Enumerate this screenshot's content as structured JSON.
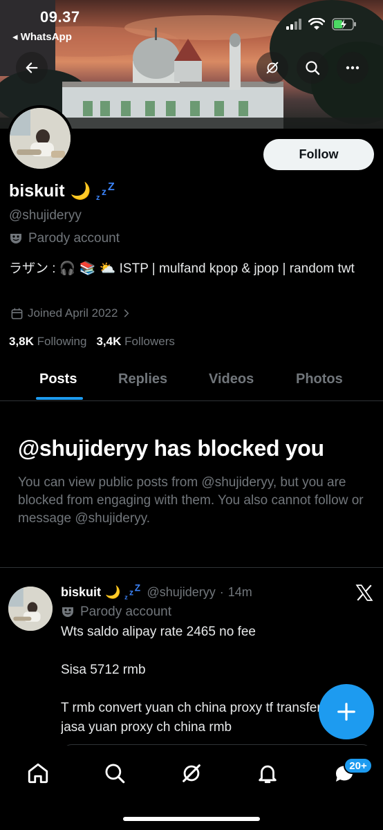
{
  "status_bar": {
    "time": "09.37",
    "back_app": "◂ WhatsApp"
  },
  "header": {
    "back_icon": "arrow-left-icon",
    "actions": [
      "grok-icon",
      "search-icon",
      "more-icon"
    ]
  },
  "profile": {
    "display_name": "biskuit",
    "name_emoji": "🌙",
    "handle": "@shujideryy",
    "parody_label": "Parody account",
    "bio": "ラザン : 🎧 📚 ⛅ ISTP | mulfand kpop & jpop | random twt",
    "joined": "Joined April 2022",
    "following_count": "3,8K",
    "following_label": "Following",
    "followers_count": "3,4K",
    "followers_label": "Followers",
    "follow_button": "Follow"
  },
  "tabs": [
    {
      "label": "Posts",
      "active": true
    },
    {
      "label": "Replies",
      "active": false
    },
    {
      "label": "Videos",
      "active": false
    },
    {
      "label": "Photos",
      "active": false
    }
  ],
  "blocked": {
    "title": "@shujideryy has blocked you",
    "description": "You can view public posts from @shujideryy, but you are blocked from engaging with them. You also cannot follow or message @shujideryy."
  },
  "post": {
    "name": "biskuit",
    "name_emoji": "🌙",
    "handle": "@shujideryy",
    "separator": "·",
    "time": "14m",
    "parody_label": "Parody account",
    "body": "Wts saldo alipay rate 2465 no fee\n\nSisa 5712 rmb\n\nT rmb convert yuan ch china proxy tf transfer\njasa yuan proxy ch china rmb"
  },
  "fab": {
    "icon": "plus-icon"
  },
  "bottom_nav": {
    "items": [
      "home-icon",
      "search-icon",
      "grok-icon",
      "notifications-icon",
      "messages-icon"
    ],
    "messages_badge": "20+"
  },
  "colors": {
    "accent": "#1d9bf0",
    "muted_text": "#71767b",
    "background": "#000000"
  }
}
